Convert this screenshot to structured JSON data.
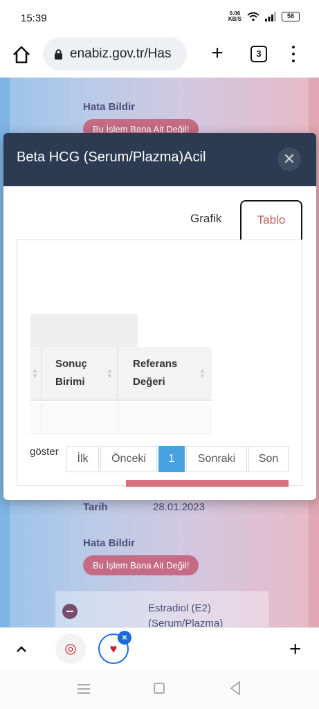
{
  "status_bar": {
    "time": "15:39",
    "net_speed_value": "0.06",
    "net_speed_unit": "KB/S",
    "battery": "58"
  },
  "browser": {
    "url": "enabiz.gov.tr/Has",
    "tab_count": "3"
  },
  "background_page": {
    "hata_bildir_1": "Hata Bildir",
    "pill_1": "Bu İşlem Bana Ait Değil!",
    "tarih_label": "Tarih",
    "tarih_value": "28.01.2023",
    "hata_bildir_2": "Hata Bildir",
    "pill_2": "Bu İşlem Bana Ait Değil!",
    "estradiol_line1": "Estradiol (E2)",
    "estradiol_line2": "(Serum/Plazma)"
  },
  "modal": {
    "title": "Beta HCG (Serum/Plazma)Acil",
    "close_symbol": "✕",
    "tabs": {
      "grafik": "Grafik",
      "tablo": "Tablo"
    },
    "table": {
      "col_sonuc_1": "Sonuç",
      "col_sonuc_2": "Birimi",
      "col_referans_1": "Referans",
      "col_referans_2": "Değeri"
    },
    "goster": "göster",
    "pagination": {
      "first": "İlk",
      "prev": "Önceki",
      "current": "1",
      "next": "Sonraki",
      "last": "Son"
    }
  },
  "colors": {
    "header_bg": "#2c3b52",
    "accent_red": "#c25a5a",
    "page_active": "#47a3e0"
  }
}
